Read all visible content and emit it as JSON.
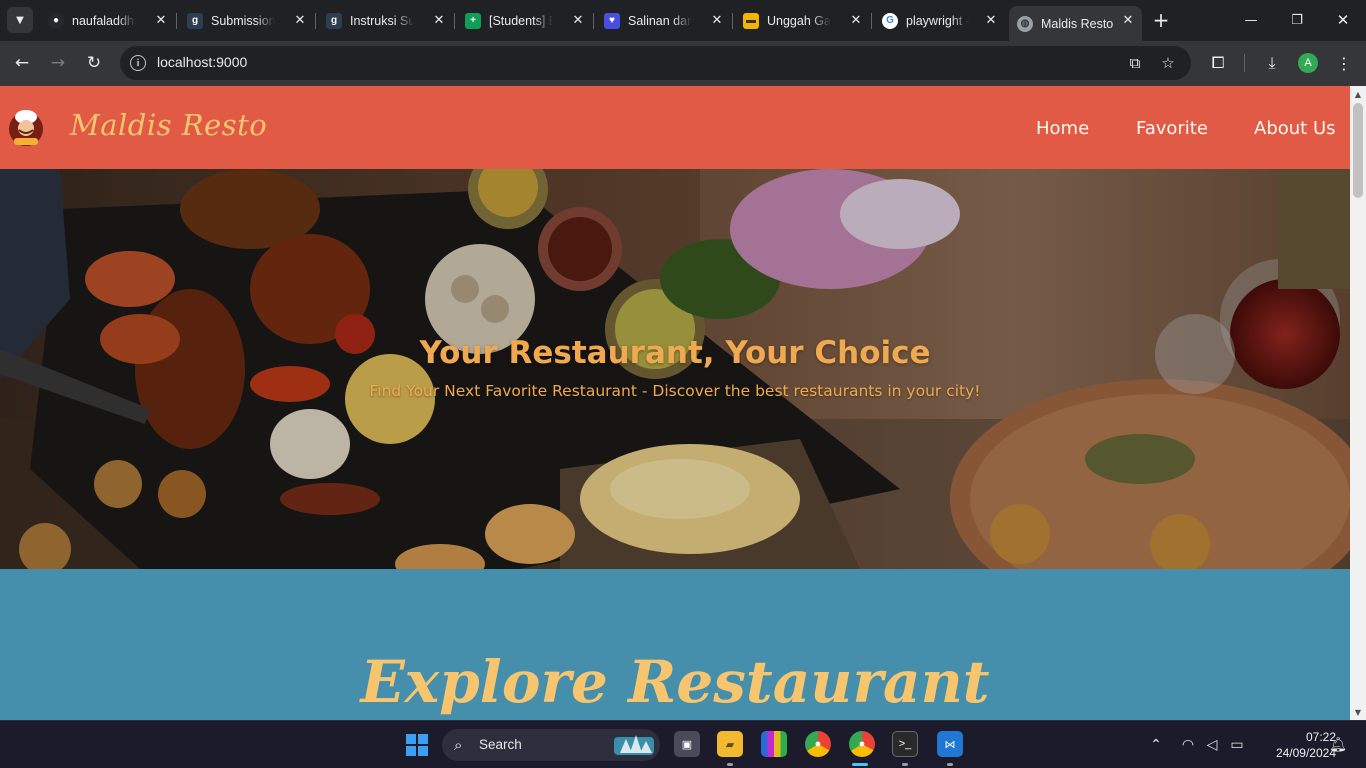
{
  "browser": {
    "tabs": [
      {
        "label": "naufaladdhiya",
        "favicon": "github-icon",
        "color": "#24292f"
      },
      {
        "label": "Submission: ",
        "favicon": "dicoding-icon",
        "color": "#2d3e50"
      },
      {
        "label": "Instruksi Sub",
        "favicon": "dicoding-icon",
        "color": "#2d3e50"
      },
      {
        "label": "[Students] Bu",
        "favicon": "sheets-icon",
        "color": "#0f9d58"
      },
      {
        "label": "Salinan dari ",
        "favicon": "heart-doc-icon",
        "color": "#4a4ee0"
      },
      {
        "label": "Unggah Gam",
        "favicon": "slides-icon",
        "color": "#f4b400"
      },
      {
        "label": "playwright - ",
        "favicon": "google-icon",
        "color": "#ffffff"
      },
      {
        "label": "Maldis Resto",
        "favicon": "globe-icon",
        "color": "#9aa0a6",
        "active": true
      }
    ],
    "url": "localhost:9000",
    "profile_initial": "A"
  },
  "site": {
    "brand": "Maldis Resto",
    "nav": [
      "Home",
      "Favorite",
      "About Us"
    ],
    "hero": {
      "title": "Your Restaurant, Your Choice",
      "subtitle": "Find Your Next Favorite Restaurant - Discover the best restaurants in your city!"
    },
    "section_title": "Explore Restaurant",
    "colors": {
      "header": "#e05a46",
      "accent": "#f7c56d",
      "section_bg": "#458eac"
    }
  },
  "taskbar": {
    "search_label": "Search",
    "time": "07:22",
    "date": "24/09/2024",
    "apps": [
      "task-view-icon",
      "file-explorer-icon",
      "winrar-icon",
      "chrome-icon",
      "chrome-profile-icon",
      "terminal-icon",
      "vscode-icon"
    ],
    "tray": [
      "chevron-up-icon",
      "wifi-icon",
      "volume-icon",
      "battery-icon",
      "bell-icon"
    ]
  }
}
